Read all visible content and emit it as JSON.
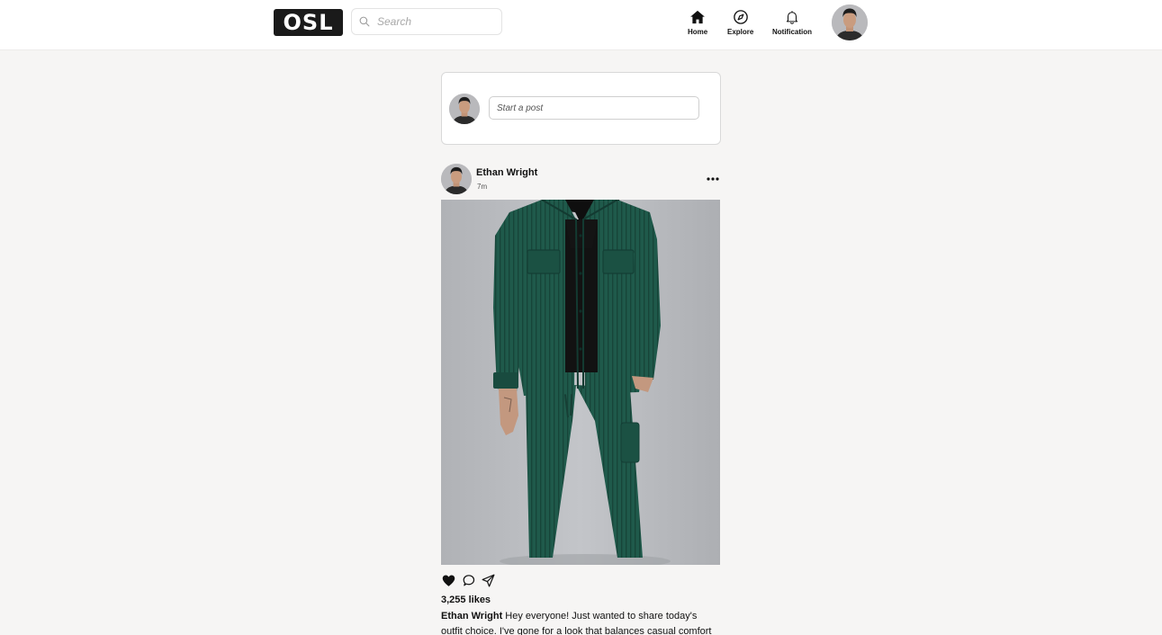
{
  "header": {
    "logo_text": "OSL",
    "search": {
      "placeholder": "Search",
      "value": "",
      "icon": "search-icon"
    },
    "nav": [
      {
        "label": "Home",
        "icon": "home-icon",
        "active": true
      },
      {
        "label": "Explore",
        "icon": "compass-icon",
        "active": false
      },
      {
        "label": "Notification",
        "icon": "bell-icon",
        "active": false
      }
    ],
    "profile_avatar": "avatar"
  },
  "composer": {
    "placeholder": "Start a post",
    "value": ""
  },
  "post": {
    "author": "Ethan Wright",
    "time": "7m",
    "menu_icon": "more-icon",
    "actions": [
      "heart-icon",
      "comment-icon",
      "share-icon"
    ],
    "likes": "3,255 likes",
    "caption_author": "Ethan Wright",
    "caption_text": "Hey everyone! Just wanted to share today's outfit choice. I've gone for a look that balances casual comfort with a"
  },
  "colors": {
    "page_background": "#f6f5f4",
    "topbar_background": "#ffffff",
    "outfit_green": "#1f5a4b",
    "photo_background": "#b5b7bb"
  }
}
